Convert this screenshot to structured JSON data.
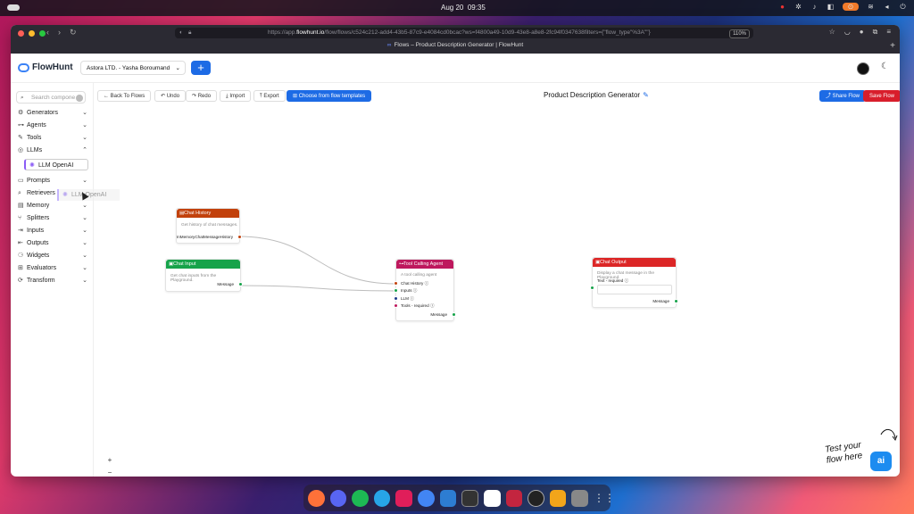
{
  "os": {
    "date": "Aug 20",
    "time": "09:35"
  },
  "browser": {
    "url_prefix": "https://app.",
    "url_domain": "flowhunt.io",
    "url_rest": "/flow/flows/c524c212-add4-43b5-87c9-e4084cd0bcac?ws=f4800a49-10d9-43e8-a8e8-2fc94f0347638filters={\"flow_type\"%3A\"\"}",
    "zoom": "110%",
    "tab_title": "Flows – Product Description Generator | FlowHunt"
  },
  "app": {
    "logo_text": "FlowHunt",
    "org_name": "Astora LTD. - Yasha Boroumand",
    "add_label": "+"
  },
  "sidebar": {
    "search_placeholder": "Search compone",
    "categories": [
      {
        "label": "Generators",
        "icon": "generators-icon"
      },
      {
        "label": "Agents",
        "icon": "agents-icon"
      },
      {
        "label": "Tools",
        "icon": "tools-icon"
      },
      {
        "label": "LLMs",
        "icon": "llms-icon"
      },
      {
        "label": "Prompts",
        "icon": "prompts-icon"
      },
      {
        "label": "Retrievers",
        "icon": "search-icon"
      },
      {
        "label": "Memory",
        "icon": "memory-icon"
      },
      {
        "label": "Splitters",
        "icon": "splitters-icon"
      },
      {
        "label": "Inputs",
        "icon": "inputs-icon"
      },
      {
        "label": "Outputs",
        "icon": "outputs-icon"
      },
      {
        "label": "Widgets",
        "icon": "widgets-icon"
      },
      {
        "label": "Evaluators",
        "icon": "evaluators-icon"
      },
      {
        "label": "Transform",
        "icon": "transform-icon"
      }
    ],
    "expanded_item": "LLM OpenAI",
    "drag_ghost": "LLM OpenAI"
  },
  "toolbar": {
    "back": "Back To Flows",
    "undo": "Undo",
    "redo": "Redo",
    "import": "Import",
    "export": "Export",
    "template": "Choose from flow templates",
    "flow_title": "Product Description Generator",
    "share": "Share Flow",
    "save": "Save Flow"
  },
  "nodes": {
    "chat_history": {
      "title": "Chat History",
      "desc": "Get history of chat messages.",
      "output": "InMemoryChatMessageHistory",
      "color": "#c2410c"
    },
    "chat_input": {
      "title": "Chat Input",
      "desc": "Get chat inputs from the Playground.",
      "output": "Message",
      "color": "#16a34a"
    },
    "agent": {
      "title": "Tool Calling Agent",
      "desc": "A tool calling agent",
      "inputs": [
        "Chat History",
        "Inputs",
        "LLM",
        "Tools - required"
      ],
      "output": "Message",
      "color": "#be185d"
    },
    "chat_output": {
      "title": "Chat Output",
      "desc": "Display a chat message in the Playground.",
      "field": "Text - required",
      "output": "Message",
      "color": "#dc2626"
    }
  },
  "zoom_controls": [
    "+",
    "−",
    "⛶",
    "🔒"
  ],
  "promo": {
    "line1": "Test your",
    "line2": "flow here",
    "button": "ai"
  }
}
